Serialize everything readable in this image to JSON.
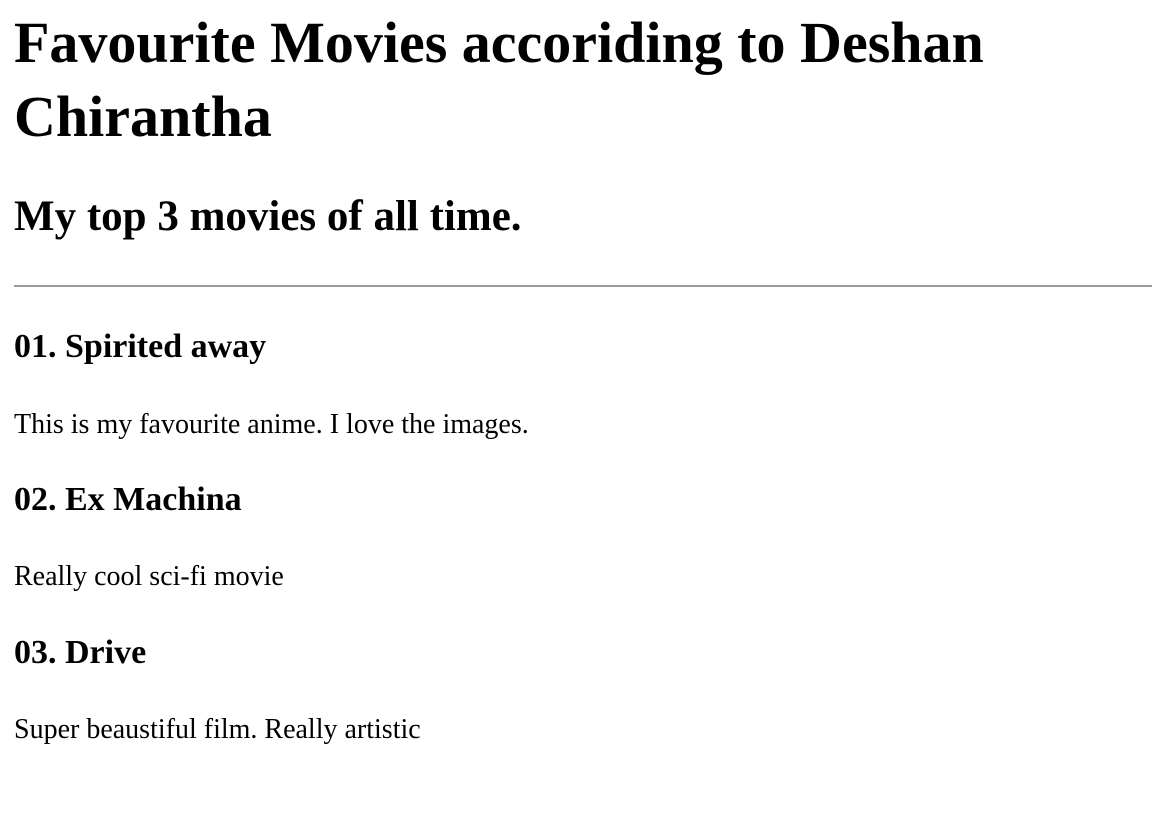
{
  "header": {
    "title": "Favourite Movies accoriding to Deshan Chirantha",
    "subtitle": "My top 3 movies of all time."
  },
  "movies": [
    {
      "title": "01. Spirited away",
      "description": "This is my favourite anime. I love the images."
    },
    {
      "title": "02. Ex Machina",
      "description": "Really cool sci-fi movie"
    },
    {
      "title": "03. Drive",
      "description": "Super beaustiful film. Really artistic"
    }
  ]
}
